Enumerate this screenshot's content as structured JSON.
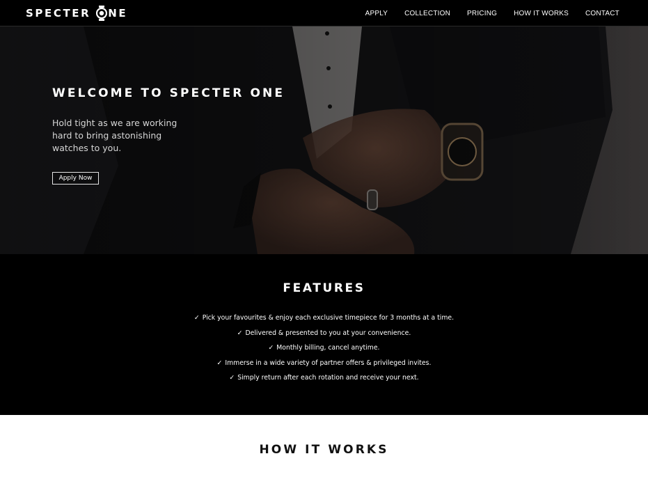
{
  "nav": {
    "logo_part1": "SPECTER",
    "logo_part2": "NE",
    "logo_icon": "watch-o-icon",
    "links": [
      "APPLY",
      "COLLECTION",
      "PRICING",
      "HOW IT WORKS",
      "CONTACT"
    ]
  },
  "hero": {
    "title": "WELCOME TO SPECTER ONE",
    "subtitle": "Hold tight as we are working hard to bring astonishing watches to you.",
    "button_label": "Apply Now",
    "image": "man-in-suit-adjusting-cuff-with-wristwatch"
  },
  "features": {
    "title": "FEATURES",
    "check_icon": "✓",
    "items": [
      "Pick your favourites & enjoy each exclusive timepiece for 3 months at a time.",
      "Delivered & presented to you at your convenience.",
      "Monthly billing, cancel anytime.",
      "Immerse in a wide variety of partner offers & privileged invites.",
      "Simply return after each rotation and receive your next."
    ]
  },
  "how_it_works": {
    "title": "HOW IT WORKS"
  },
  "colors": {
    "nav_bg": "#000000",
    "features_bg": "#000000",
    "page_bg": "#ffffff",
    "text_light": "#ffffff",
    "text_dark": "#111111"
  }
}
